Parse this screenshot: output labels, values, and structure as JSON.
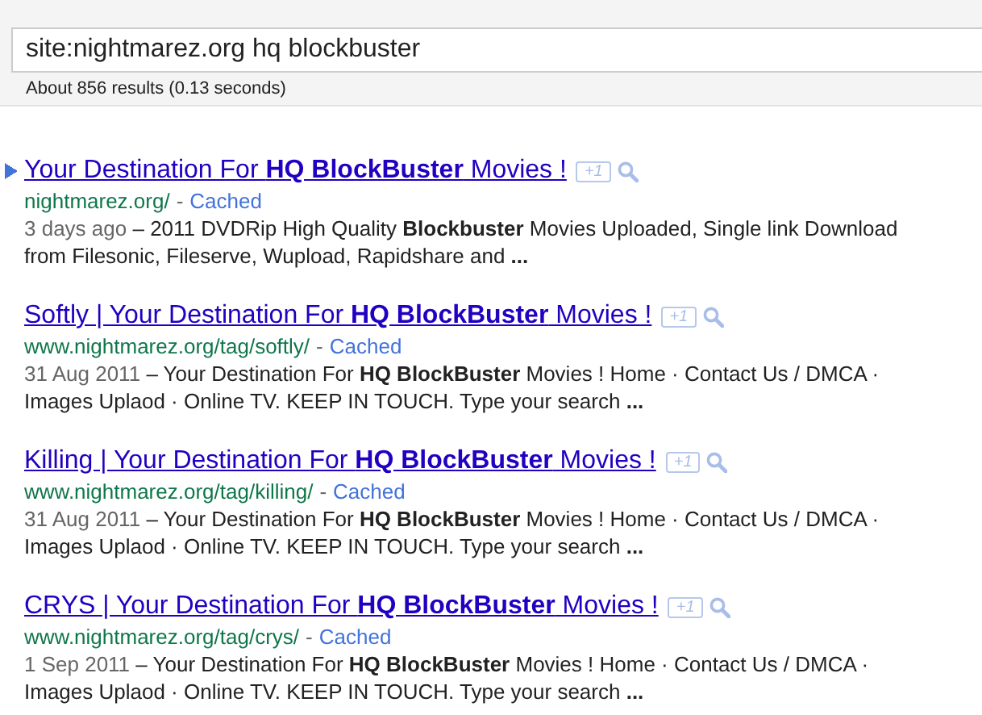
{
  "search": {
    "value": "site:nightmarez.org hq blockbuster"
  },
  "result_stats": "About 856 results (0.13 seconds)",
  "results": [
    {
      "selected": true,
      "title": "Your Destination For **HQ BlockBuster** Movies !",
      "plus_one": "+1",
      "url": "nightmarez.org/",
      "separator": "-",
      "cached": "Cached",
      "date": "3 days ago",
      "snippet": "– 2011 DVDRip High Quality **Blockbuster** Movies Uploaded, Single link Download from Filesonic, Fileserve, Wupload, Rapidshare and **...**"
    },
    {
      "selected": false,
      "title": "Softly | Your Destination For **HQ BlockBuster** Movies !",
      "plus_one": "+1",
      "url": "www.nightmarez.org/tag/softly/",
      "separator": "-",
      "cached": "Cached",
      "date": "31 Aug 2011",
      "snippet": "– Your Destination For **HQ BlockBuster** Movies ! Home · Contact Us / DMCA · Images Uplaod · Online TV. KEEP IN TOUCH. Type your search **...**"
    },
    {
      "selected": false,
      "title": "Killing | Your Destination For **HQ BlockBuster** Movies !",
      "plus_one": "+1",
      "url": "www.nightmarez.org/tag/killing/",
      "separator": "-",
      "cached": "Cached",
      "date": "31 Aug 2011",
      "snippet": "– Your Destination For **HQ BlockBuster** Movies ! Home · Contact Us / DMCA · Images Uplaod · Online TV. KEEP IN TOUCH. Type your search **...**"
    },
    {
      "selected": false,
      "title": "CRYS | Your Destination For **HQ BlockBuster** Movies !",
      "plus_one": "+1",
      "url": "www.nightmarez.org/tag/crys/",
      "separator": "-",
      "cached": "Cached",
      "date": "1 Sep 2011",
      "snippet": "– Your Destination For **HQ BlockBuster** Movies ! Home · Contact Us / DMCA · Images Uplaod · Online TV. KEEP IN TOUCH. Type your search **...**"
    }
  ]
}
